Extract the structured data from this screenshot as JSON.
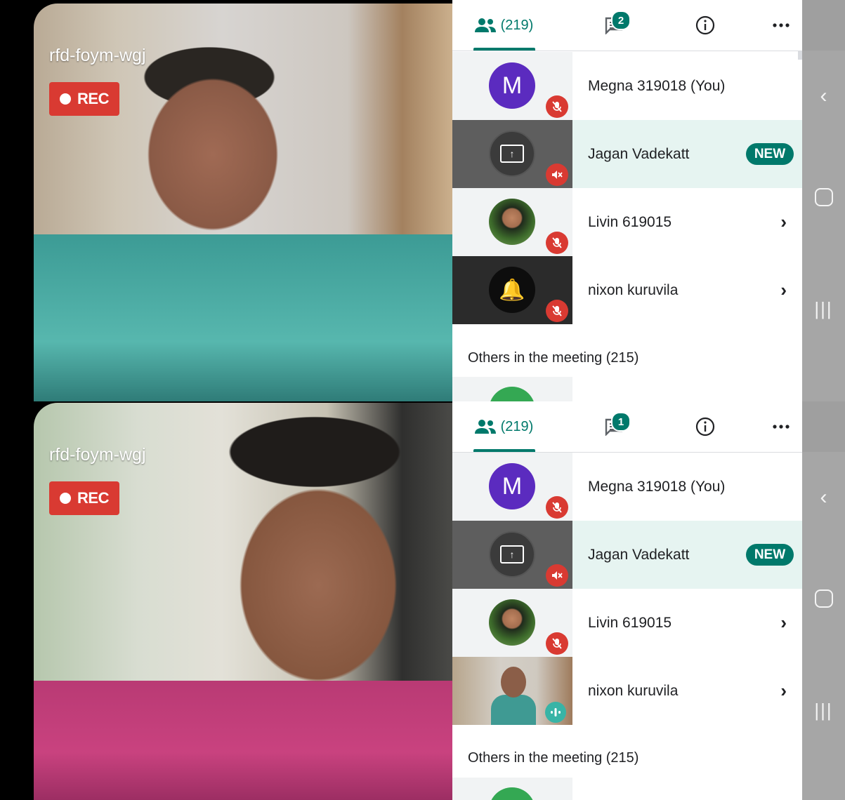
{
  "meeting": {
    "code": "rfd-foym-wgj",
    "rec_label": "REC"
  },
  "screens": [
    {
      "tabs": {
        "people_count": "(219)",
        "chat_badge": "2"
      },
      "participants": [
        {
          "name": "Megna 319018 (You)",
          "avatar_letter": "M",
          "muted": true
        },
        {
          "name": "Jagan Vadekatt",
          "badge": "NEW",
          "muted": true,
          "presenting": true
        },
        {
          "name": "Livin 619015",
          "muted": true
        },
        {
          "name": "nixon kuruvila",
          "muted": true
        }
      ],
      "others_label": "Others in the meeting (215)"
    },
    {
      "tabs": {
        "people_count": "(219)",
        "chat_badge": "1"
      },
      "participants": [
        {
          "name": "Megna 319018 (You)",
          "avatar_letter": "M",
          "muted": true
        },
        {
          "name": "Jagan Vadekatt",
          "badge": "NEW",
          "muted": true,
          "presenting": true
        },
        {
          "name": "Livin 619015",
          "muted": true
        },
        {
          "name": "nixon kuruvila",
          "speaking": true
        }
      ],
      "others_label": "Others in the meeting (215)"
    }
  ],
  "icons": {
    "people": "people-icon",
    "chat": "chat-icon",
    "info": "info-icon",
    "more": "more-icon",
    "mic_off": "mic-off-icon",
    "present": "present-screen-icon",
    "chevron": "chevron-right-icon",
    "bell": "bell-icon",
    "nav_back": "back-icon",
    "nav_home": "home-icon",
    "nav_recent": "recents-icon"
  },
  "colors": {
    "accent": "#00796b",
    "rec": "#d93a32",
    "highlight": "#e6f4f1",
    "avatar_m": "#5b2bbf"
  }
}
